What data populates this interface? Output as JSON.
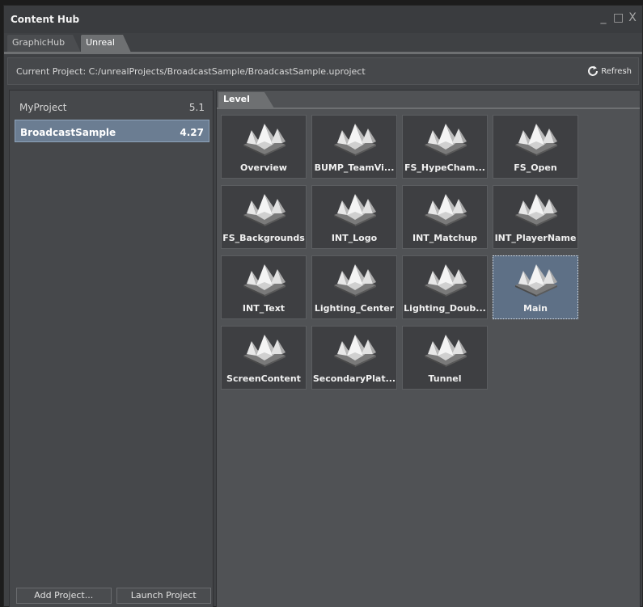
{
  "window": {
    "title": "Content Hub"
  },
  "window_controls": {
    "minimize": "_",
    "maximize": "□",
    "close": "X"
  },
  "tabs": [
    {
      "label": "GraphicHub",
      "active": false
    },
    {
      "label": "Unreal",
      "active": true
    }
  ],
  "path_bar": {
    "label": "Current Project: C:/unrealProjects/BroadcastSample/BroadcastSample.uproject",
    "refresh_label": "Refresh",
    "refresh_icon": "refresh-icon"
  },
  "projects": [
    {
      "name": "MyProject",
      "version": "5.1",
      "selected": false
    },
    {
      "name": "BroadcastSample",
      "version": "4.27",
      "selected": true
    }
  ],
  "buttons": {
    "add_project": "Add Project...",
    "launch_project": "Launch Project"
  },
  "level_tab": "Level",
  "levels": [
    {
      "label": "Overview"
    },
    {
      "label": "BUMP_TeamVi..."
    },
    {
      "label": "FS_HypeCham..."
    },
    {
      "label": "FS_Open"
    },
    {
      "label": "FS_Backgrounds"
    },
    {
      "label": "INT_Logo"
    },
    {
      "label": "INT_Matchup"
    },
    {
      "label": "INT_PlayerName"
    },
    {
      "label": "INT_Text"
    },
    {
      "label": "Lighting_Center"
    },
    {
      "label": "Lighting_Doub..."
    },
    {
      "label": "Main",
      "selected": true
    },
    {
      "label": "ScreenContent"
    },
    {
      "label": "SecondaryPlat..."
    },
    {
      "label": "Tunnel"
    }
  ],
  "colors": {
    "selection": "#6b7d92",
    "panel": "#505255",
    "tile": "#3e3f42"
  }
}
